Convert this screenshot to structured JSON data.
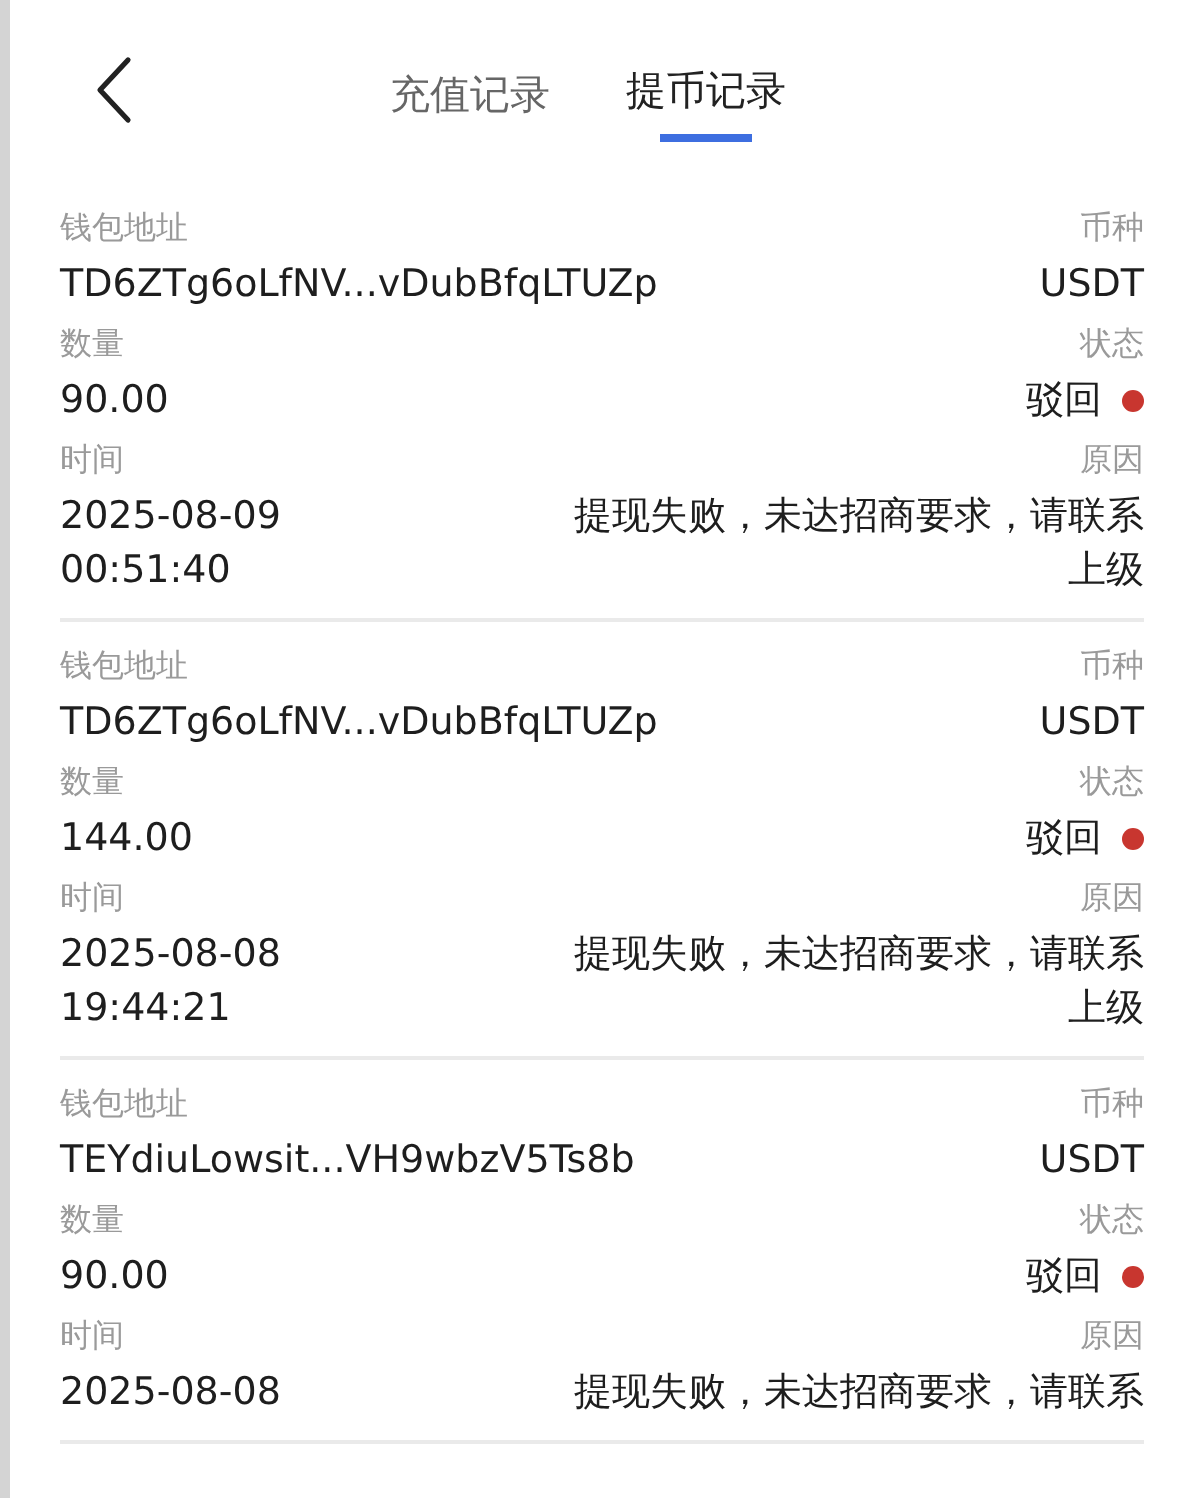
{
  "header": {
    "back_icon": true
  },
  "tabs": [
    {
      "label": "充值记录",
      "selected": false
    },
    {
      "label": "提币记录",
      "selected": true
    }
  ],
  "records": [
    {
      "address_label": "钱包地址",
      "address": "TD6ZTg6oLfNV...vDubBfqLTUZp",
      "currency_label": "币种",
      "currency": "USDT",
      "amount_label": "数量",
      "amount": "90.00",
      "status_label": "状态",
      "status": "驳回",
      "color": "#c8362f",
      "time_label": "时间",
      "time": [
        "2025-08-09",
        "00:51:40"
      ],
      "reason_label": "原因",
      "reason": [
        "提现失败，未达招商要求，请联系",
        "上级"
      ]
    },
    {
      "address_label": "钱包地址",
      "address": "TD6ZTg6oLfNV...vDubBfqLTUZp",
      "currency_label": "币种",
      "currency": "USDT",
      "amount_label": "数量",
      "amount": "144.00",
      "status_label": "状态",
      "status": "驳回",
      "color": "#c8362f",
      "time_label": "时间",
      "time": [
        "2025-08-08",
        "19:44:21"
      ],
      "reason_label": "原因",
      "reason": [
        "提现失败，未达招商要求，请联系",
        "上级"
      ]
    },
    {
      "address_label": "钱包地址",
      "address": "TEYdiuLowsit...VH9wbzV5Ts8b",
      "currency_label": "币种",
      "currency": "USDT",
      "amount_label": "数量",
      "amount": "90.00",
      "status_label": "状态",
      "status": "驳回",
      "color": "#c8362f",
      "time_label": "时间",
      "time": [
        "2025-08-08"
      ],
      "reason_label": "原因",
      "reason": [
        "提现失败，未达招商要求，请联系"
      ]
    }
  ]
}
